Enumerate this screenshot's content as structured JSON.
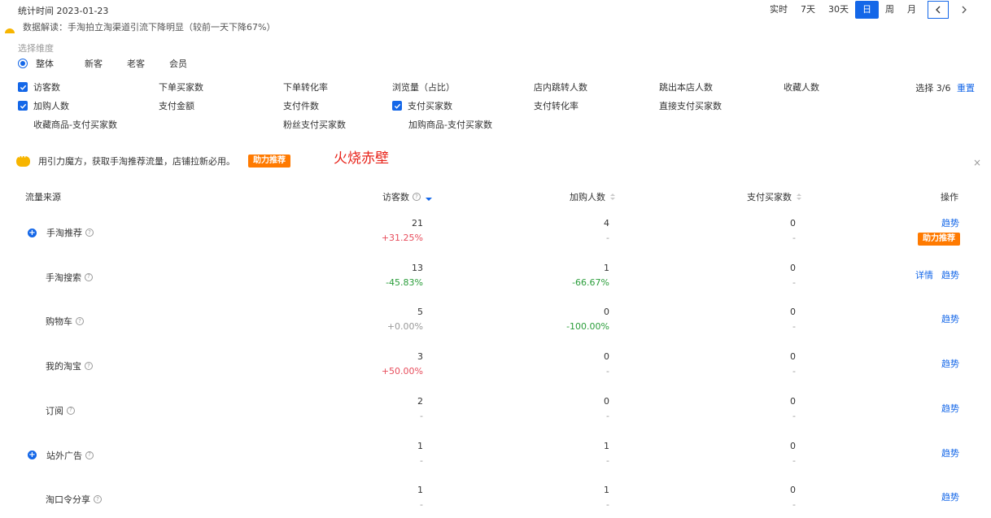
{
  "header": {
    "stat_time": "统计时间 2023-01-23",
    "ranges": [
      "实时",
      "7天",
      "30天",
      "日",
      "周",
      "月"
    ],
    "active_range": "日",
    "prev_icon": "chevron-left-icon",
    "next_icon": "chevron-right-icon"
  },
  "insight": {
    "text": "数据解读：手淘拍立淘渠道引流下降明显（较前一天下降67%）"
  },
  "dimension": {
    "label": "选择维度",
    "options": [
      "整体",
      "新客",
      "老客",
      "会员"
    ],
    "selected": "整体"
  },
  "metrics": {
    "items": [
      {
        "label": "访客数",
        "checked": true
      },
      {
        "label": "下单买家数",
        "checked": false
      },
      {
        "label": "下单转化率",
        "checked": false
      },
      {
        "label": "浏览量（占比）",
        "checked": false
      },
      {
        "label": "店内跳转人数",
        "checked": false
      },
      {
        "label": "跳出本店人数",
        "checked": false
      },
      {
        "label": "收藏人数",
        "checked": false
      },
      {
        "label": "加购人数",
        "checked": true
      },
      {
        "label": "支付金额",
        "checked": false
      },
      {
        "label": "支付件数",
        "checked": false
      },
      {
        "label": "支付买家数",
        "checked": true
      },
      {
        "label": "支付转化率",
        "checked": false
      },
      {
        "label": "直接支付买家数",
        "checked": false
      },
      {
        "label": "收藏商品-支付买家数",
        "checked": false
      },
      {
        "label": "粉丝支付买家数",
        "checked": false
      },
      {
        "label": "加购商品-支付买家数",
        "checked": false
      }
    ],
    "select_count": "选择 3/6",
    "reset": "重置"
  },
  "promo": {
    "text": "用引力魔方，获取手淘推荐流量，店铺拉新必用。",
    "button": "助力推荐",
    "overlay_text": "火烧赤壁",
    "close": "×"
  },
  "table": {
    "headers": {
      "source": "流量来源",
      "visitors": "访客数",
      "cart": "加购人数",
      "buyers": "支付买家数",
      "ops": "操作"
    },
    "rows": [
      {
        "name": "手淘推荐",
        "expand": true,
        "visitors": "21",
        "visitors_delta": "+31.25%",
        "v_trend": "up",
        "cart": "4",
        "cart_delta": "-",
        "c_trend": "flat",
        "buyers": "0",
        "buyers_delta": "-",
        "ops": [
          "趋势"
        ],
        "boost": "助力推荐"
      },
      {
        "name": "手淘搜索",
        "expand": false,
        "visitors": "13",
        "visitors_delta": "-45.83%",
        "v_trend": "down",
        "cart": "1",
        "cart_delta": "-66.67%",
        "c_trend": "down",
        "buyers": "0",
        "buyers_delta": "-",
        "ops": [
          "详情",
          "趋势"
        ]
      },
      {
        "name": "购物车",
        "expand": false,
        "visitors": "5",
        "visitors_delta": "+0.00%",
        "v_trend": "flat",
        "cart": "0",
        "cart_delta": "-100.00%",
        "c_trend": "down",
        "buyers": "0",
        "buyers_delta": "-",
        "ops": [
          "趋势"
        ]
      },
      {
        "name": "我的淘宝",
        "expand": false,
        "visitors": "3",
        "visitors_delta": "+50.00%",
        "v_trend": "up",
        "cart": "0",
        "cart_delta": "-",
        "c_trend": "flat",
        "buyers": "0",
        "buyers_delta": "-",
        "ops": [
          "趋势"
        ]
      },
      {
        "name": "订阅",
        "expand": false,
        "visitors": "2",
        "visitors_delta": "-",
        "v_trend": "flat",
        "cart": "0",
        "cart_delta": "-",
        "c_trend": "flat",
        "buyers": "0",
        "buyers_delta": "-",
        "ops": [
          "趋势"
        ]
      },
      {
        "name": "站外广告",
        "expand": true,
        "visitors": "1",
        "visitors_delta": "-",
        "v_trend": "flat",
        "cart": "1",
        "cart_delta": "-",
        "c_trend": "flat",
        "buyers": "0",
        "buyers_delta": "-",
        "ops": [
          "趋势"
        ]
      },
      {
        "name": "淘口令分享",
        "expand": false,
        "visitors": "1",
        "visitors_delta": "-",
        "v_trend": "flat",
        "cart": "1",
        "cart_delta": "-",
        "c_trend": "flat",
        "buyers": "0",
        "buyers_delta": "-",
        "ops": [
          "趋势"
        ]
      }
    ]
  },
  "colors": {
    "primary": "#1467e8",
    "orange": "#ff7a00",
    "up": "#e74c5b",
    "down": "#2a9d3a",
    "red_text": "#e8231a"
  }
}
